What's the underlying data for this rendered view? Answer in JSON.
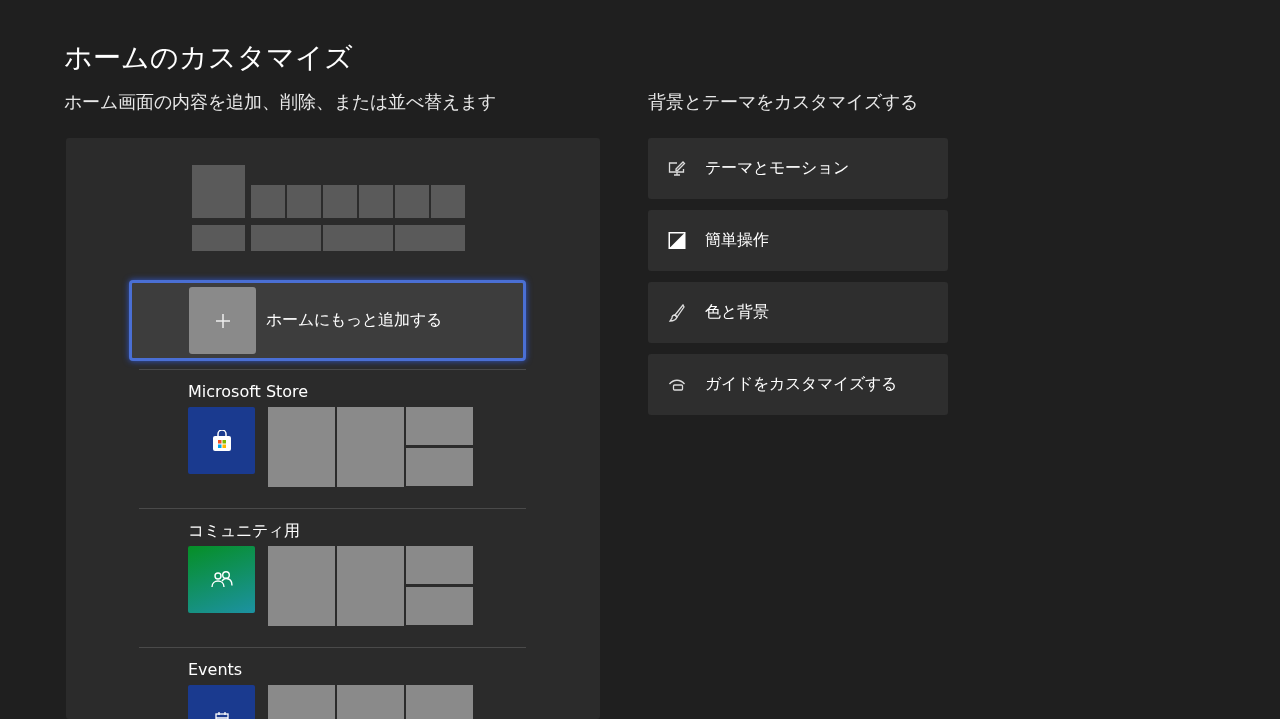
{
  "header": {
    "title": "ホームのカスタマイズ",
    "subtitle": "ホーム画面の内容を追加、削除、または並べ替えます"
  },
  "home_panel": {
    "add_button": {
      "label": "ホームにもっと追加する",
      "selected": true
    },
    "sections": [
      {
        "title": "Microsoft Store",
        "color": "#1a3a8f",
        "kind": "split"
      },
      {
        "title": "コミュニティ用",
        "color": "#1a9a6a",
        "kind": "split"
      },
      {
        "title": "Events",
        "color": "#1a3a8f",
        "kind": "row"
      }
    ]
  },
  "customize": {
    "title": "背景とテーマをカスタマイズする",
    "options": [
      {
        "label": "テーマとモーション"
      },
      {
        "label": "簡単操作"
      },
      {
        "label": "色と背景"
      },
      {
        "label": "ガイドをカスタマイズする"
      }
    ]
  }
}
